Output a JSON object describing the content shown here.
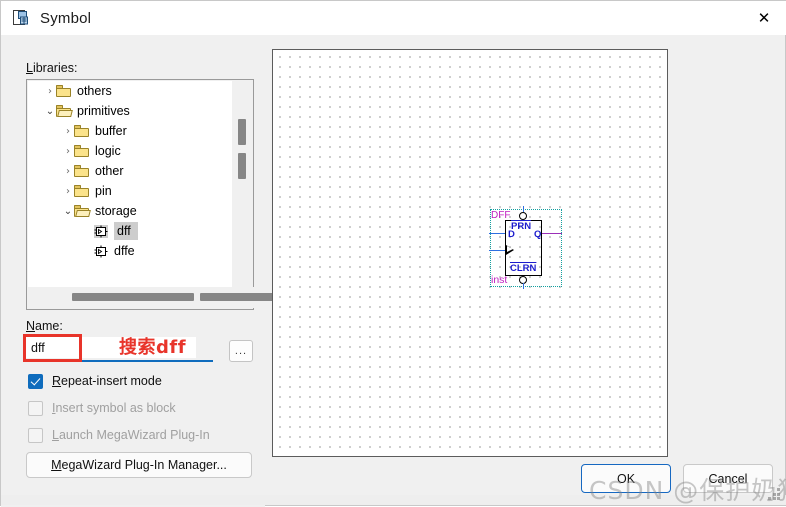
{
  "window": {
    "title": "Symbol",
    "icon": "symbol-document-icon",
    "close_label": "✕"
  },
  "left": {
    "libraries_label_accel": "L",
    "libraries_label_rest": "ibraries:",
    "tree": [
      {
        "label": "others",
        "depth": 1,
        "arrow": "›",
        "expanded": false,
        "kind": "folder",
        "selected": false
      },
      {
        "label": "primitives",
        "depth": 1,
        "arrow": "⌄",
        "expanded": true,
        "kind": "folder",
        "selected": false
      },
      {
        "label": "buffer",
        "depth": 2,
        "arrow": "›",
        "expanded": false,
        "kind": "folder",
        "selected": false
      },
      {
        "label": "logic",
        "depth": 2,
        "arrow": "›",
        "expanded": false,
        "kind": "folder",
        "selected": false
      },
      {
        "label": "other",
        "depth": 2,
        "arrow": "›",
        "expanded": false,
        "kind": "folder",
        "selected": false
      },
      {
        "label": "pin",
        "depth": 2,
        "arrow": "›",
        "expanded": false,
        "kind": "folder",
        "selected": false
      },
      {
        "label": "storage",
        "depth": 2,
        "arrow": "⌄",
        "expanded": true,
        "kind": "folder",
        "selected": false
      },
      {
        "label": "dff",
        "depth": 3,
        "arrow": "",
        "expanded": false,
        "kind": "symbol",
        "selected": true
      },
      {
        "label": "dffe",
        "depth": 3,
        "arrow": "",
        "expanded": false,
        "kind": "symbol",
        "selected": false
      }
    ],
    "name_label_accel": "N",
    "name_label_rest": "ame:",
    "name_value": "dff",
    "name_placeholder": "",
    "browse_label": "...",
    "annotation_text": "搜索dff",
    "checkboxes": [
      {
        "accel": "R",
        "rest": "epeat-insert mode",
        "checked": true,
        "enabled": true
      },
      {
        "accel": "I",
        "rest": "nsert symbol as block",
        "checked": false,
        "enabled": false
      },
      {
        "accel": "L",
        "rest": "aunch MegaWizard Plug-In",
        "checked": false,
        "enabled": false
      }
    ],
    "megawizard_accel": "M",
    "megawizard_rest": "egaWizard Plug-In Manager..."
  },
  "preview": {
    "symbol_name": "DFF",
    "instance_name": "inst",
    "pins": {
      "d": "D",
      "q": "Q",
      "prn": "PRN",
      "clrn": "CLRN"
    }
  },
  "footer": {
    "ok_label": "OK",
    "cancel_label": "Cancel"
  },
  "watermark": {
    "text": "CSDN @保护奶猫"
  },
  "colors": {
    "accent_blue": "#0f6cbd",
    "annotation_red": "#e8342a",
    "symbol_label_magenta": "#c020c0",
    "symbol_pin_blue": "#1c1ccd",
    "selection_teal": "#12a0a0",
    "output_wire_purple": "#9b2fb8",
    "input_wire_blue": "#2f6fe0",
    "folder_yellow": "#fbe38b"
  }
}
